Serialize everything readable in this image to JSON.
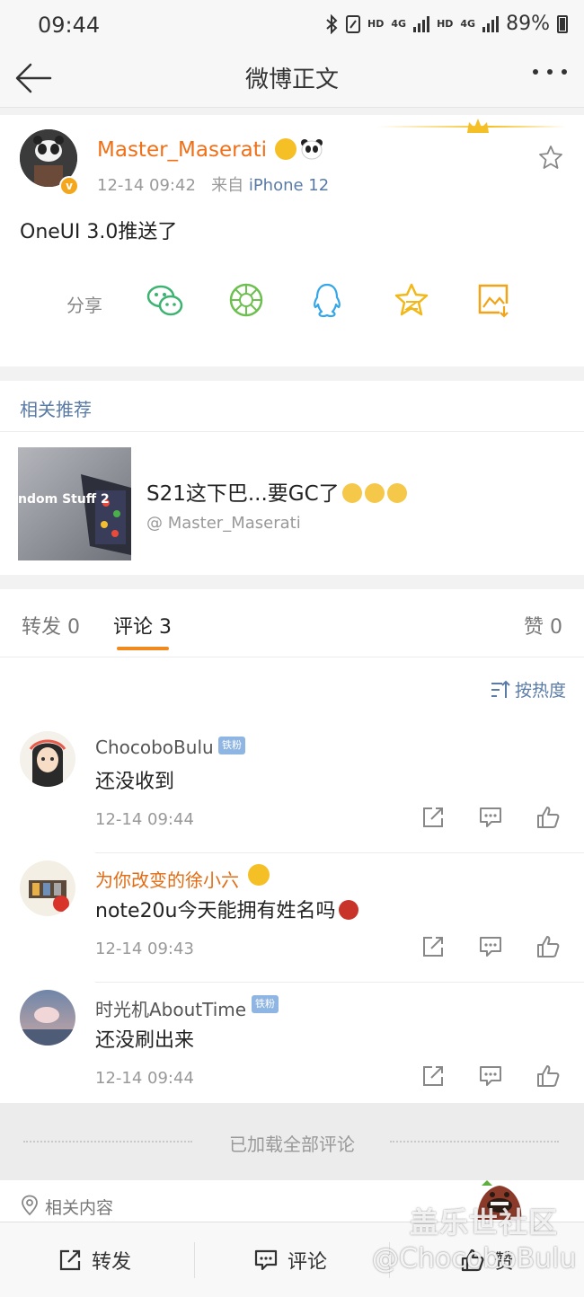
{
  "status_bar": {
    "time": "09:44",
    "hd1": "HD",
    "net1": "4G",
    "hd2": "HD",
    "net2": "4G",
    "battery": "89%"
  },
  "title_bar": {
    "title": "微博正文",
    "back_icon": "arrow-left-icon",
    "more_icon": "more-dots-icon"
  },
  "post": {
    "author": "Master_Maserati",
    "time": "12-14 09:42",
    "via_prefix": "来自",
    "source": "iPhone 12",
    "verified_mark": "v",
    "text": "OneUI 3.0推送了",
    "share_label": "分享",
    "share_targets": [
      "wechat-icon",
      "moments-icon",
      "qq-icon",
      "qzone-icon",
      "save-image-icon"
    ]
  },
  "related": {
    "header": "相关推荐",
    "item": {
      "title": "S21这下巴...要GC了",
      "user": "@ Master_Maserati",
      "thumb_caption": "ndom Stuff 2"
    }
  },
  "tabs": [
    {
      "label": "转发 0"
    },
    {
      "label": "评论 3"
    },
    {
      "label": "赞 0"
    }
  ],
  "sort_label": "按热度",
  "comments": [
    {
      "name": "ChocoboBulu",
      "badge": "铁粉",
      "text": "还没收到",
      "time": "12-14 09:44"
    },
    {
      "name": "为你改变的徐小六",
      "badge": "",
      "text": "note20u今天能拥有姓名吗",
      "time": "12-14 09:43"
    },
    {
      "name": "时光机AboutTime",
      "badge": "铁粉",
      "text": "还没刷出来",
      "time": "12-14 09:44"
    }
  ],
  "comment_actions": [
    "repost-icon",
    "reply-icon",
    "like-icon"
  ],
  "loaded_all": "已加载全部评论",
  "related_content": "相关内容",
  "bottom_bar": {
    "repost": "转发",
    "comment": "评论",
    "like": "赞"
  },
  "watermark": {
    "line1": "盖乐世社区",
    "line2": "@ChocoboBulu"
  },
  "colors": {
    "orange_name": "#f07018",
    "link_blue": "#5a7ba6",
    "tab_underline": "#f08a1e",
    "badge_blue": "#8fb6e3"
  }
}
